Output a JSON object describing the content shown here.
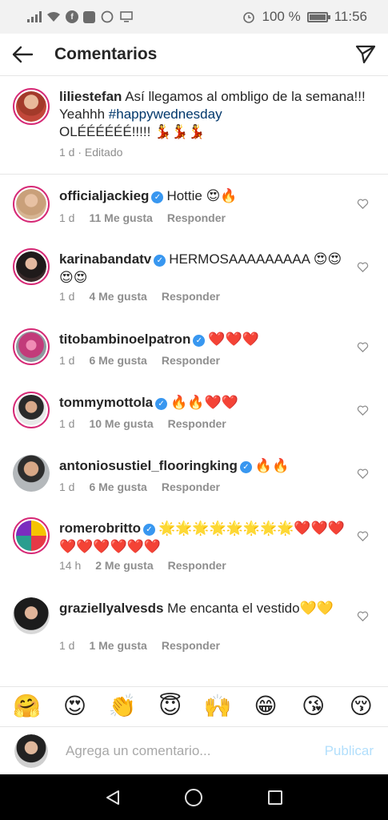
{
  "status_bar": {
    "battery": "100 %",
    "time": "11:56",
    "icons": [
      "signal-icon",
      "wifi-icon",
      "facebook-icon",
      "app-icon",
      "whatsapp-icon",
      "monitor-icon",
      "alarm-icon",
      "battery-icon"
    ]
  },
  "header": {
    "title": "Comentarios",
    "back_icon": "arrow-left-icon",
    "send_icon": "send-icon"
  },
  "caption": {
    "username": "liliestefan",
    "text": "Así llegamos al ombligo de la semana!!! Yeahhh",
    "hashtag": "#happywednesday",
    "text2": "OLÉÉÉÉÉÉ!!!!! 💃💃💃",
    "time": "1 d",
    "edited": "Editado",
    "separator": "·"
  },
  "comments": [
    {
      "username": "officialjackieg",
      "text": "Hottie 😍🔥",
      "time": "1 d",
      "likes": "11 Me gusta",
      "reply": "Responder"
    },
    {
      "username": "karinabandatv",
      "text": "HERMOSAAAAAAAAA 😍😍😍😍",
      "time": "1 d",
      "likes": "4 Me gusta",
      "reply": "Responder"
    },
    {
      "username": "titobambinoelpatron",
      "text": "❤️❤️❤️",
      "time": "1 d",
      "likes": "6 Me gusta",
      "reply": "Responder"
    },
    {
      "username": "tommymottola",
      "text": "🔥🔥❤️❤️",
      "time": "1 d",
      "likes": "10 Me gusta",
      "reply": "Responder"
    },
    {
      "username": "antoniosustiel_flooringking",
      "text": "🔥🔥",
      "time": "1 d",
      "likes": "6 Me gusta",
      "reply": "Responder"
    },
    {
      "username": "romerobritto",
      "text": "🌟🌟🌟🌟🌟🌟🌟🌟❤️❤️❤️❤️❤️❤️❤️❤️❤️",
      "time": "14 h",
      "likes": "2 Me gusta",
      "reply": "Responder"
    },
    {
      "username": "graziellyalvesds",
      "text": "Me encanta el vestido💛💛",
      "time": "1 d",
      "likes": "1 Me gusta",
      "reply": "Responder"
    }
  ],
  "emoji_bar": [
    "🤗",
    "😍",
    "👏",
    "😇",
    "🙌",
    "😁",
    "😘",
    "😚"
  ],
  "input": {
    "placeholder": "Agrega un comentario...",
    "publish": "Publicar"
  },
  "colors": {
    "accent": "#3897f0",
    "publish_disabled": "#b2dffc",
    "story_ring": "#d62976",
    "hashtag": "#00376b"
  }
}
